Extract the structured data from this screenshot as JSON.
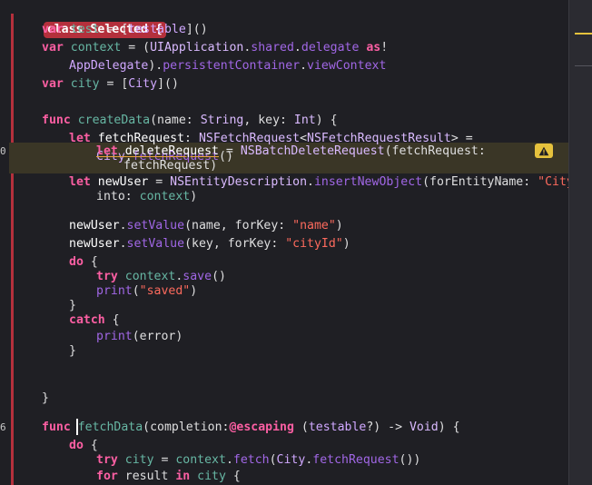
{
  "editor": {
    "gutter_numbers": [
      "0",
      "6"
    ],
    "lines": {
      "l1": {
        "class_decl": "class Selected {"
      },
      "l2": {
        "a": "var ",
        "b": "test",
        "c": " = [",
        "d": "testable",
        "e": "]()"
      },
      "l3": {
        "a": "var ",
        "b": "context",
        "c": " = (",
        "d": "UIApplication",
        "e": ".",
        "f": "shared",
        "g": ".",
        "h": "delegate",
        "i": " as",
        "j": "!"
      },
      "l4": {
        "a": "AppDelegate",
        "b": ").",
        "c": "persistentContainer",
        "d": ".",
        "e": "viewContext"
      },
      "l5": {
        "a": "var ",
        "b": "city",
        "c": " = [",
        "d": "City",
        "e": "]()"
      },
      "l7": {
        "a": "func ",
        "b": "createData",
        "c": "(name: ",
        "d": "String",
        "e": ", key: ",
        "f": "Int",
        "g": ") {"
      },
      "l8": {
        "a": "let ",
        "b": "fetchRequest",
        "c": ": ",
        "d": "NSFetchRequest",
        "e": "<",
        "f": "NSFetchRequestResult",
        "g": "> ="
      },
      "l9": {
        "a": "City",
        "b": ".",
        "c": "fetchRequest",
        "d": "()"
      },
      "l10": {
        "a": "let",
        "b": " deleteRequest",
        "c": " = ",
        "d": "NSBatchDeleteRequest",
        "e": "(fetchRequest:"
      },
      "l11": {
        "a": "fetchRequest",
        "b": ")"
      },
      "l12": {
        "a": "let ",
        "b": "newUser",
        "c": " = ",
        "d": "NSEntityDescription",
        "e": ".",
        "f": "insertNewObject",
        "g": "(forEntityName: ",
        "h": "\"City\"",
        "i": ","
      },
      "l13": {
        "a": "into: ",
        "b": "context",
        "c": ")"
      },
      "l15": {
        "a": "newUser",
        "b": ".",
        "c": "setValue",
        "d": "(name, forKey: ",
        "e": "\"name\"",
        "f": ")"
      },
      "l16": {
        "a": "newUser",
        "b": ".",
        "c": "setValue",
        "d": "(key, forKey: ",
        "e": "\"cityId\"",
        "f": ")"
      },
      "l17": {
        "a": "do",
        "b": " {"
      },
      "l18": {
        "a": "try ",
        "b": "context",
        "c": ".",
        "d": "save",
        "e": "()"
      },
      "l19": {
        "a": "print",
        "b": "(",
        "c": "\"saved\"",
        "d": ")"
      },
      "l20": {
        "a": "}"
      },
      "l21": {
        "a": "catch",
        "b": " {"
      },
      "l22": {
        "a": "print",
        "b": "(error)"
      },
      "l23": {
        "a": "}"
      },
      "l26": {
        "a": "}"
      },
      "l28": {
        "a": "func ",
        "b": "fetchData",
        "c": "(completion:",
        "d": "@escaping",
        "e": " (",
        "f": "testable",
        "g": "?) -> ",
        "h": "Void",
        "i": ") {"
      },
      "l29": {
        "a": "do",
        "b": " {"
      },
      "l30": {
        "a": "try ",
        "b": "city",
        "c": " = ",
        "d": "context",
        "e": ".",
        "f": "fetch",
        "g": "(",
        "h": "City",
        "i": ".",
        "j": "fetchRequest",
        "k": "())"
      },
      "l31": {
        "a": "for ",
        "b": "result",
        "c": " in ",
        "d": "city",
        "e": " {"
      }
    },
    "warning_badge": "warning-icon"
  },
  "colors": {
    "background": "#1f1f24",
    "keyword": "#fc5fa3",
    "type": "#d0a8ff",
    "string": "#fc6a5d",
    "scope_bar": "#b4303c",
    "warning": "#e6c23d"
  }
}
